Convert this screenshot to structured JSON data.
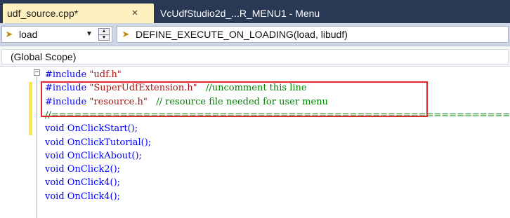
{
  "tabs": [
    {
      "label": "udf_source.cpp*",
      "active": true,
      "close_glyph": "×"
    },
    {
      "label": "VcUdfStudio2d_...R_MENU1 - Menu",
      "active": false
    }
  ],
  "nav": {
    "member_combo": {
      "icon": "member-icon",
      "value": "load"
    },
    "definition_combo": {
      "icon": "member-icon",
      "value": "DEFINE_EXECUTE_ON_LOADING(load, libudf)"
    }
  },
  "scope": {
    "label": "(Global Scope)"
  },
  "editor": {
    "lines": [
      [
        {
          "t": "#include ",
          "k": "dir"
        },
        {
          "t": "\"udf.h\"",
          "k": "str"
        }
      ],
      [
        {
          "t": "#include ",
          "k": "dir"
        },
        {
          "t": "\"SuperUdfExtension.h\"",
          "k": "str"
        },
        {
          "t": "   //uncomment this line",
          "k": "cmt"
        }
      ],
      [
        {
          "t": "#include ",
          "k": "dir"
        },
        {
          "t": "\"resource.h\"",
          "k": "str"
        },
        {
          "t": "   // resource file needed for user menu",
          "k": "cmt"
        }
      ],
      [
        {
          "t": "//=============================================================",
          "k": "cmt"
        }
      ],
      [
        {
          "t": "void ",
          "k": "kw"
        },
        {
          "t": "OnClickStart();",
          "k": "fn"
        }
      ],
      [
        {
          "t": "void ",
          "k": "kw"
        },
        {
          "t": "OnClickTutorial();",
          "k": "fn"
        }
      ],
      [
        {
          "t": "void ",
          "k": "kw"
        },
        {
          "t": "OnClickAbout();",
          "k": "fn"
        }
      ],
      [
        {
          "t": "void ",
          "k": "kw"
        },
        {
          "t": "OnClick2();",
          "k": "fn"
        }
      ],
      [
        {
          "t": "void ",
          "k": "kw"
        },
        {
          "t": "OnClick4();",
          "k": "fn"
        }
      ],
      [
        {
          "t": "void ",
          "k": "kw"
        },
        {
          "t": "OnClick4();",
          "k": "fn"
        }
      ]
    ],
    "colors": {
      "directive": "#0000ff",
      "string": "#a31515",
      "comment": "#008000",
      "highlight_box": "#e0282d",
      "change_bar": "#f7e93e"
    }
  }
}
